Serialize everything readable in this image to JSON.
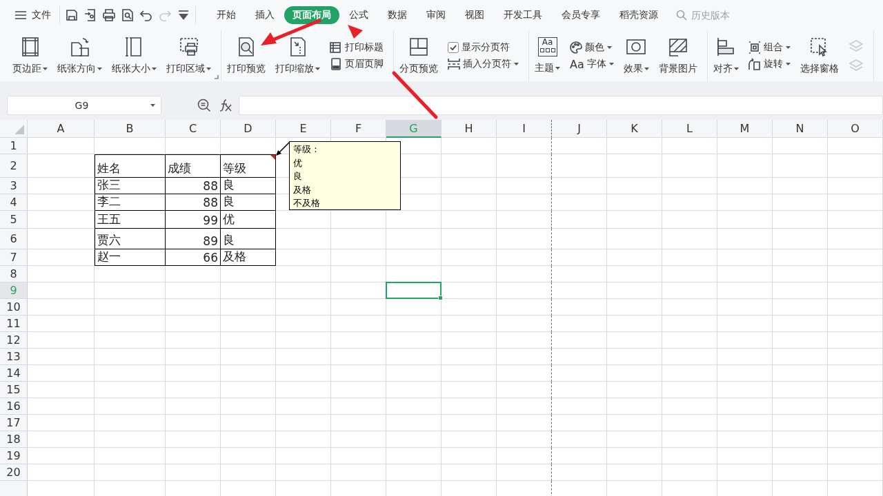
{
  "menu": {
    "label": "文件"
  },
  "quick_access": [
    {
      "kind": "save",
      "disabled": false
    },
    {
      "kind": "export",
      "disabled": false
    },
    {
      "kind": "print",
      "disabled": false
    },
    {
      "kind": "preview",
      "disabled": false
    },
    {
      "kind": "undo",
      "disabled": false
    },
    {
      "kind": "redo",
      "disabled": true
    },
    {
      "kind": "more",
      "disabled": false
    }
  ],
  "tabs": [
    {
      "label": "开始",
      "selected": false
    },
    {
      "label": "插入",
      "selected": false
    },
    {
      "label": "页面布局",
      "selected": true
    },
    {
      "label": "公式",
      "selected": false
    },
    {
      "label": "数据",
      "selected": false
    },
    {
      "label": "审阅",
      "selected": false
    },
    {
      "label": "视图",
      "selected": false
    },
    {
      "label": "开发工具",
      "selected": false
    },
    {
      "label": "会员专享",
      "selected": false
    },
    {
      "label": "稻壳资源",
      "selected": false
    }
  ],
  "search": {
    "placeholder": "历史版本"
  },
  "ribbon": {
    "groups": [
      {
        "launcher": true,
        "items": [
          {
            "kind": "large",
            "label": "页边距",
            "dropdown": true
          },
          {
            "kind": "large",
            "label": "纸张方向",
            "dropdown": true
          },
          {
            "kind": "large",
            "label": "纸张大小",
            "dropdown": true
          },
          {
            "kind": "large",
            "label": "打印区域",
            "dropdown": true
          }
        ]
      },
      {
        "launcher": false,
        "items": [
          {
            "kind": "large",
            "label": "打印预览",
            "dropdown": false
          },
          {
            "kind": "large",
            "label": "打印缩放",
            "dropdown": true
          },
          {
            "kind": "stack",
            "items": [
              {
                "kind": "small",
                "label": "打印标题",
                "dropdown": false
              },
              {
                "kind": "small",
                "label": "页眉页脚",
                "dropdown": false
              }
            ]
          }
        ]
      },
      {
        "launcher": false,
        "items": [
          {
            "kind": "large",
            "label": "分页预览",
            "dropdown": false
          },
          {
            "kind": "stack",
            "items": [
              {
                "kind": "checkbox",
                "label": "显示分页符",
                "checked": true
              },
              {
                "kind": "small",
                "label": "插入分页符",
                "dropdown": true
              }
            ]
          }
        ]
      },
      {
        "launcher": false,
        "items": [
          {
            "kind": "large",
            "label": "主题",
            "dropdown": true,
            "icon_text": "Aa"
          },
          {
            "kind": "stack",
            "items": [
              {
                "kind": "small",
                "label": "颜色",
                "dropdown": true
              },
              {
                "kind": "small",
                "label": "字体",
                "dropdown": true,
                "icon_text": "Aa"
              }
            ]
          },
          {
            "kind": "large",
            "label": "效果",
            "dropdown": true
          },
          {
            "kind": "large",
            "label": "背景图片",
            "dropdown": false
          }
        ]
      },
      {
        "launcher": false,
        "items": [
          {
            "kind": "large",
            "label": "对齐",
            "dropdown": true
          },
          {
            "kind": "stack",
            "items": [
              {
                "kind": "small",
                "label": "组合",
                "dropdown": true
              },
              {
                "kind": "small",
                "label": "旋转",
                "dropdown": true
              }
            ]
          },
          {
            "kind": "large",
            "label": "选择窗格",
            "dropdown": false
          },
          {
            "kind": "stack",
            "items": [
              {
                "kind": "faded"
              },
              {
                "kind": "faded"
              }
            ]
          }
        ]
      }
    ]
  },
  "formula_bar": {
    "name_box": "G9"
  },
  "sheet": {
    "columns": [
      {
        "label": "A",
        "selected": false,
        "page_break": false
      },
      {
        "label": "B",
        "selected": false,
        "page_break": false
      },
      {
        "label": "C",
        "selected": false,
        "page_break": false
      },
      {
        "label": "D",
        "selected": false,
        "page_break": false
      },
      {
        "label": "E",
        "selected": false,
        "page_break": false
      },
      {
        "label": "F",
        "selected": false,
        "page_break": false
      },
      {
        "label": "G",
        "selected": true,
        "page_break": false
      },
      {
        "label": "H",
        "selected": false,
        "page_break": false
      },
      {
        "label": "I",
        "selected": false,
        "page_break": true
      },
      {
        "label": "J",
        "selected": false,
        "page_break": false
      },
      {
        "label": "K",
        "selected": false,
        "page_break": false
      },
      {
        "label": "L",
        "selected": false,
        "page_break": false
      },
      {
        "label": "M",
        "selected": false,
        "page_break": false
      },
      {
        "label": "N",
        "selected": false,
        "page_break": false
      },
      {
        "label": "O",
        "selected": false,
        "page_break": false
      }
    ],
    "rows": [
      {
        "label": "1",
        "selected": false
      },
      {
        "label": "2",
        "selected": false
      },
      {
        "label": "3",
        "selected": false
      },
      {
        "label": "4",
        "selected": false
      },
      {
        "label": "5",
        "selected": false
      },
      {
        "label": "6",
        "selected": false
      },
      {
        "label": "7",
        "selected": false
      },
      {
        "label": "8",
        "selected": false
      },
      {
        "label": "9",
        "selected": true
      },
      {
        "label": "10",
        "selected": false
      },
      {
        "label": "11",
        "selected": false
      },
      {
        "label": "12",
        "selected": false
      },
      {
        "label": "13",
        "selected": false
      },
      {
        "label": "14",
        "selected": false
      },
      {
        "label": "15",
        "selected": false
      },
      {
        "label": "16",
        "selected": false
      },
      {
        "label": "17",
        "selected": false
      },
      {
        "label": "18",
        "selected": false
      },
      {
        "label": "19",
        "selected": false
      },
      {
        "label": "20",
        "selected": false
      }
    ],
    "table": {
      "header": [
        "姓名",
        "成绩",
        "等级"
      ],
      "rows": [
        [
          "张三",
          "88",
          "良"
        ],
        [
          "李二",
          "88",
          "良"
        ],
        [
          "王五",
          "99",
          "优"
        ],
        [
          "贾六",
          "89",
          "良"
        ],
        [
          "赵一",
          "66",
          "及格"
        ]
      ]
    },
    "comment": {
      "lines": [
        "等级：",
        "优",
        "良",
        "及格",
        "不及格"
      ]
    }
  }
}
